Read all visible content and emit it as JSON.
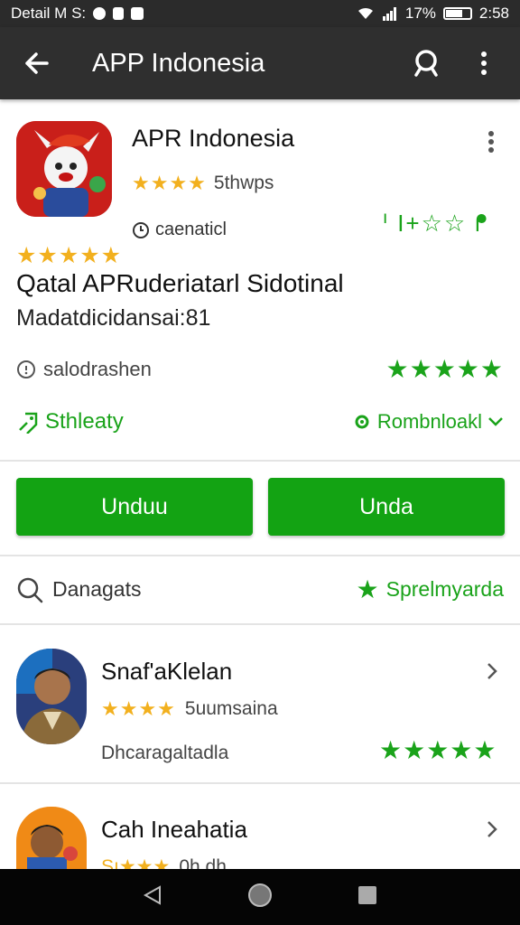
{
  "status_bar": {
    "left_text": "Detail M S:",
    "battery": "17%",
    "time": "2:58"
  },
  "app_bar": {
    "title": "APP Indonesia",
    "icons": [
      "back-arrow-icon",
      "search-icon",
      "more-vert-icon"
    ]
  },
  "app": {
    "name": "APR Indonesia",
    "rating_text": "5thwps",
    "category": "caenaticl",
    "badges": "ᑊ I+☆☆ ᖰ",
    "headline": "Qatal APRuderiatarl Sidotinal",
    "subline": "Madatdicidansai:81",
    "meta_label": "salodrashen",
    "link_left": "Sthleaty",
    "link_right": "Rombnloakl"
  },
  "buttons": {
    "primary": "Unduu",
    "secondary": "Unda"
  },
  "section": {
    "search_label": "Danagats",
    "right_label": "Sprelmyarda"
  },
  "list": [
    {
      "title": "Snaf'aKlelan",
      "rating_text": "5uumsaina",
      "subtitle": "Dhcaragaltadla"
    },
    {
      "title": "Cah Ineahatia",
      "stars_prefix": "Sı",
      "rating_text": "0h dh"
    }
  ],
  "colors": {
    "accent_green": "#13a313",
    "star_gold": "#f2b01e",
    "app_bar": "#2f2f2f"
  }
}
